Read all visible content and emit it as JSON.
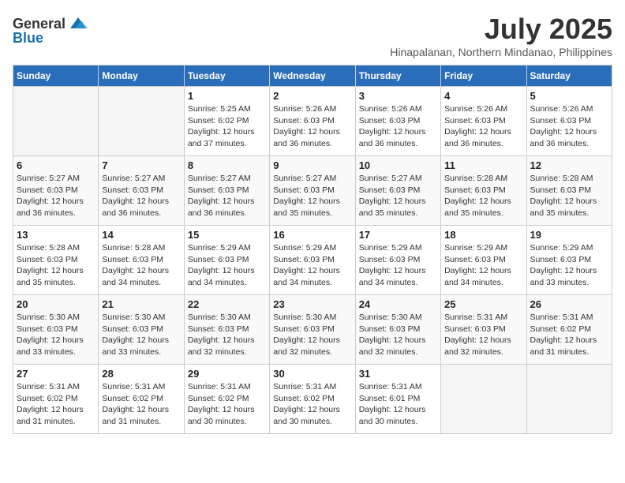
{
  "header": {
    "logo_general": "General",
    "logo_blue": "Blue",
    "title": "July 2025",
    "subtitle": "Hinapalanan, Northern Mindanao, Philippines"
  },
  "weekdays": [
    "Sunday",
    "Monday",
    "Tuesday",
    "Wednesday",
    "Thursday",
    "Friday",
    "Saturday"
  ],
  "weeks": [
    [
      {
        "day": "",
        "info": ""
      },
      {
        "day": "",
        "info": ""
      },
      {
        "day": "1",
        "sunrise": "5:25 AM",
        "sunset": "6:02 PM",
        "daylight": "12 hours and 37 minutes."
      },
      {
        "day": "2",
        "sunrise": "5:26 AM",
        "sunset": "6:03 PM",
        "daylight": "12 hours and 36 minutes."
      },
      {
        "day": "3",
        "sunrise": "5:26 AM",
        "sunset": "6:03 PM",
        "daylight": "12 hours and 36 minutes."
      },
      {
        "day": "4",
        "sunrise": "5:26 AM",
        "sunset": "6:03 PM",
        "daylight": "12 hours and 36 minutes."
      },
      {
        "day": "5",
        "sunrise": "5:26 AM",
        "sunset": "6:03 PM",
        "daylight": "12 hours and 36 minutes."
      }
    ],
    [
      {
        "day": "6",
        "sunrise": "5:27 AM",
        "sunset": "6:03 PM",
        "daylight": "12 hours and 36 minutes."
      },
      {
        "day": "7",
        "sunrise": "5:27 AM",
        "sunset": "6:03 PM",
        "daylight": "12 hours and 36 minutes."
      },
      {
        "day": "8",
        "sunrise": "5:27 AM",
        "sunset": "6:03 PM",
        "daylight": "12 hours and 36 minutes."
      },
      {
        "day": "9",
        "sunrise": "5:27 AM",
        "sunset": "6:03 PM",
        "daylight": "12 hours and 35 minutes."
      },
      {
        "day": "10",
        "sunrise": "5:27 AM",
        "sunset": "6:03 PM",
        "daylight": "12 hours and 35 minutes."
      },
      {
        "day": "11",
        "sunrise": "5:28 AM",
        "sunset": "6:03 PM",
        "daylight": "12 hours and 35 minutes."
      },
      {
        "day": "12",
        "sunrise": "5:28 AM",
        "sunset": "6:03 PM",
        "daylight": "12 hours and 35 minutes."
      }
    ],
    [
      {
        "day": "13",
        "sunrise": "5:28 AM",
        "sunset": "6:03 PM",
        "daylight": "12 hours and 35 minutes."
      },
      {
        "day": "14",
        "sunrise": "5:28 AM",
        "sunset": "6:03 PM",
        "daylight": "12 hours and 34 minutes."
      },
      {
        "day": "15",
        "sunrise": "5:29 AM",
        "sunset": "6:03 PM",
        "daylight": "12 hours and 34 minutes."
      },
      {
        "day": "16",
        "sunrise": "5:29 AM",
        "sunset": "6:03 PM",
        "daylight": "12 hours and 34 minutes."
      },
      {
        "day": "17",
        "sunrise": "5:29 AM",
        "sunset": "6:03 PM",
        "daylight": "12 hours and 34 minutes."
      },
      {
        "day": "18",
        "sunrise": "5:29 AM",
        "sunset": "6:03 PM",
        "daylight": "12 hours and 34 minutes."
      },
      {
        "day": "19",
        "sunrise": "5:29 AM",
        "sunset": "6:03 PM",
        "daylight": "12 hours and 33 minutes."
      }
    ],
    [
      {
        "day": "20",
        "sunrise": "5:30 AM",
        "sunset": "6:03 PM",
        "daylight": "12 hours and 33 minutes."
      },
      {
        "day": "21",
        "sunrise": "5:30 AM",
        "sunset": "6:03 PM",
        "daylight": "12 hours and 33 minutes."
      },
      {
        "day": "22",
        "sunrise": "5:30 AM",
        "sunset": "6:03 PM",
        "daylight": "12 hours and 32 minutes."
      },
      {
        "day": "23",
        "sunrise": "5:30 AM",
        "sunset": "6:03 PM",
        "daylight": "12 hours and 32 minutes."
      },
      {
        "day": "24",
        "sunrise": "5:30 AM",
        "sunset": "6:03 PM",
        "daylight": "12 hours and 32 minutes."
      },
      {
        "day": "25",
        "sunrise": "5:31 AM",
        "sunset": "6:03 PM",
        "daylight": "12 hours and 32 minutes."
      },
      {
        "day": "26",
        "sunrise": "5:31 AM",
        "sunset": "6:02 PM",
        "daylight": "12 hours and 31 minutes."
      }
    ],
    [
      {
        "day": "27",
        "sunrise": "5:31 AM",
        "sunset": "6:02 PM",
        "daylight": "12 hours and 31 minutes."
      },
      {
        "day": "28",
        "sunrise": "5:31 AM",
        "sunset": "6:02 PM",
        "daylight": "12 hours and 31 minutes."
      },
      {
        "day": "29",
        "sunrise": "5:31 AM",
        "sunset": "6:02 PM",
        "daylight": "12 hours and 30 minutes."
      },
      {
        "day": "30",
        "sunrise": "5:31 AM",
        "sunset": "6:02 PM",
        "daylight": "12 hours and 30 minutes."
      },
      {
        "day": "31",
        "sunrise": "5:31 AM",
        "sunset": "6:01 PM",
        "daylight": "12 hours and 30 minutes."
      },
      {
        "day": "",
        "info": ""
      },
      {
        "day": "",
        "info": ""
      }
    ]
  ]
}
